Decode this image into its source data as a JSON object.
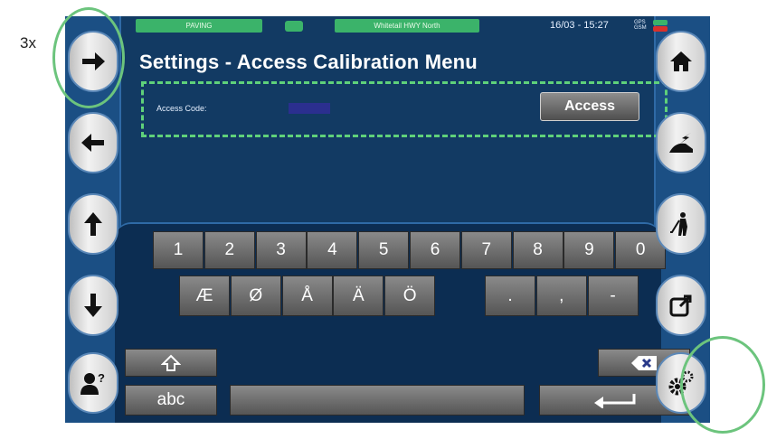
{
  "annotation": {
    "text": "3x"
  },
  "status_bar": {
    "mode": "PAVING",
    "road": "Whitetail HWY North",
    "datetime": "16/03 - 15:27",
    "gps_label": "GPS",
    "gsm_label": "GSM",
    "gps_color": "#3bb36a",
    "gsm_color": "#d9312b"
  },
  "page_title": "Settings  -  Access Calibration Menu",
  "access": {
    "label": "Access Code:",
    "code_value": "",
    "button_label": "Access"
  },
  "keyboard": {
    "digits": [
      "1",
      "2",
      "3",
      "4",
      "5",
      "6",
      "7",
      "8",
      "9",
      "0"
    ],
    "letters": [
      "Æ",
      "Ø",
      "Å",
      "Ä",
      "Ö"
    ],
    "punct": [
      ".",
      ",",
      "-"
    ],
    "abc_label": "abc"
  },
  "left_nav": [
    "arrow-right-icon",
    "arrow-left-icon",
    "arrow-up-icon",
    "arrow-down-icon",
    "user-help-icon"
  ],
  "right_nav": [
    "home-icon",
    "paver-icon",
    "worker-icon",
    "export-icon",
    "settings-gears-icon"
  ],
  "colors": {
    "screen": "#123a63",
    "accent_green": "#5fd17a",
    "key": "#6f6f6f"
  }
}
